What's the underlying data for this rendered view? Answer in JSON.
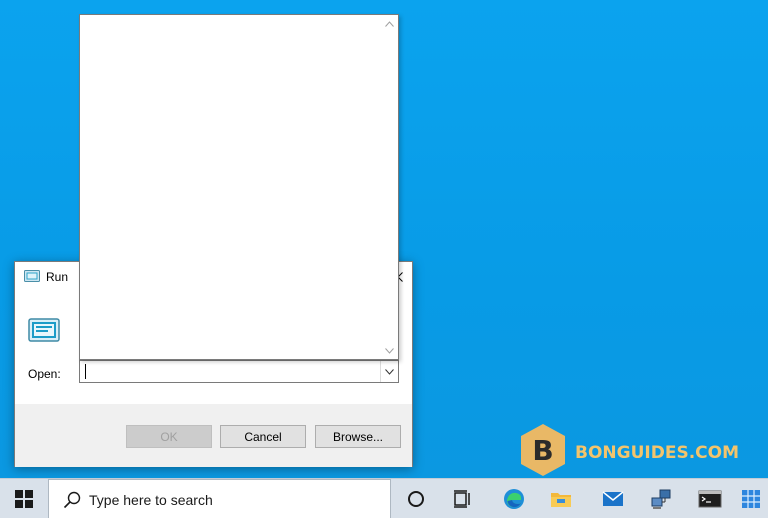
{
  "run_dialog": {
    "title": "Run",
    "open_label": "Open:",
    "command_value": "",
    "buttons": {
      "ok": "OK",
      "cancel": "Cancel",
      "browse": "Browse..."
    },
    "ok_enabled": false
  },
  "dropdown": {
    "items": []
  },
  "taskbar": {
    "search_placeholder": "Type here to search",
    "icons": [
      "windows-start-icon",
      "search-icon",
      "cortana-icon",
      "task-view-icon",
      "edge-icon",
      "file-explorer-icon",
      "mail-icon",
      "network-icon",
      "terminal-icon",
      "storage-icon"
    ]
  },
  "watermark": {
    "text": "BONGUIDES.COM",
    "logo_letter": "B"
  },
  "colors": {
    "desktop_blue": "#0a9ee9",
    "taskbar": "#d9e1ea",
    "watermark_gold": "#f3c46c"
  }
}
